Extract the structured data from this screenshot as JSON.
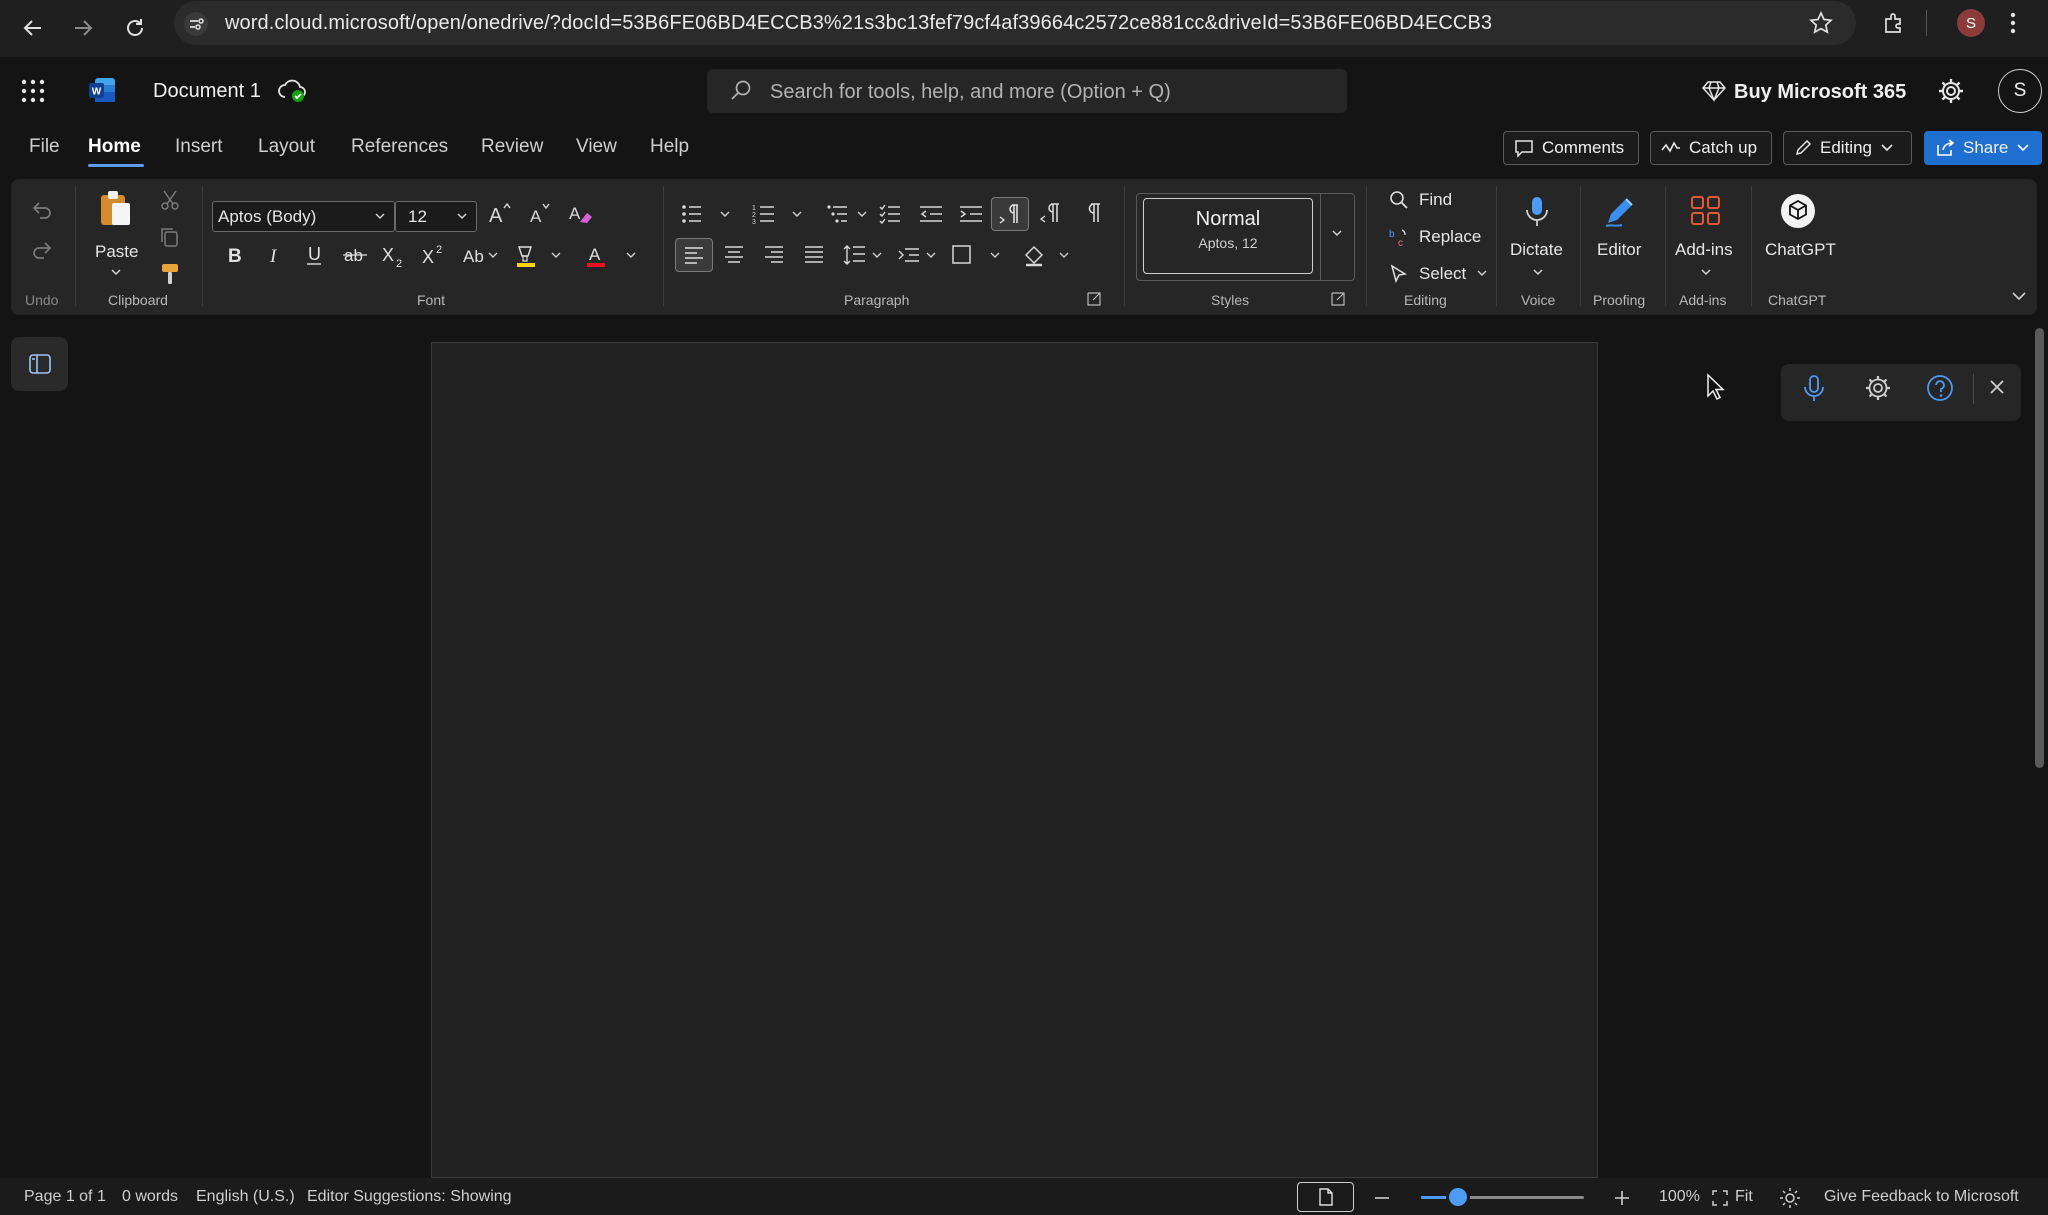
{
  "browser": {
    "url": "word.cloud.microsoft/open/onedrive/?docId=53B6FE06BD4ECCB3%21s3bc13fef79cf4af39664c2572ce881cc&driveId=53B6FE06BD4ECCB3",
    "profile_initial": "S"
  },
  "header": {
    "doc_title": "Document 1",
    "search_placeholder": "Search for tools, help, and more (Option + Q)",
    "buy_label": "Buy Microsoft 365",
    "avatar_initial": "S"
  },
  "tabs": [
    {
      "label": "File"
    },
    {
      "label": "Home",
      "active": true
    },
    {
      "label": "Insert"
    },
    {
      "label": "Layout"
    },
    {
      "label": "References"
    },
    {
      "label": "Review"
    },
    {
      "label": "View"
    },
    {
      "label": "Help"
    }
  ],
  "top_buttons": {
    "comments": "Comments",
    "catch_up": "Catch up",
    "editing": "Editing",
    "share": "Share"
  },
  "ribbon": {
    "groups": {
      "undo": "Undo",
      "clipboard": "Clipboard",
      "font": "Font",
      "paragraph": "Paragraph",
      "styles": "Styles",
      "editing": "Editing",
      "voice": "Voice",
      "proofing": "Proofing",
      "addins": "Add-ins",
      "chatgpt": "ChatGPT"
    },
    "paste_label": "Paste",
    "font_name": "Aptos (Body)",
    "font_size": "12",
    "style_name": "Normal",
    "style_detail": "Aptos, 12",
    "find_label": "Find",
    "replace_label": "Replace",
    "select_label": "Select",
    "dictate_label": "Dictate",
    "editor_label": "Editor",
    "addins_label": "Add-ins",
    "chatgpt_label": "ChatGPT"
  },
  "status": {
    "page": "Page 1 of 1",
    "words": "0 words",
    "language": "English (U.S.)",
    "editor": "Editor Suggestions: Showing",
    "zoom": "100%",
    "fit": "Fit",
    "feedback": "Give Feedback to Microsoft"
  },
  "colors": {
    "accent": "#1f6fd1",
    "font_color_underline": "#e81123",
    "highlight_yellow": "#ffd400"
  }
}
